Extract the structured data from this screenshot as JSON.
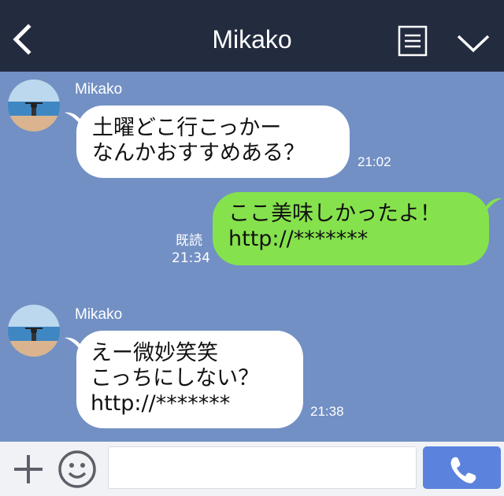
{
  "header": {
    "title": "Mikako",
    "back_icon": "chevron-left-icon",
    "menu_icon": "notes-icon",
    "expand_icon": "chevron-down-icon",
    "background_color": "#232b3f"
  },
  "chat": {
    "background_color": "#7290c4",
    "messages": [
      {
        "direction": "incoming",
        "sender": "Mikako",
        "text": "土曜どこ行こっかー\nなんかおすすめある？",
        "time": "21:02"
      },
      {
        "direction": "outgoing",
        "text": "ここ美味しかったよ！\nhttp://*******",
        "read_label": "既読",
        "time": "21:34"
      },
      {
        "direction": "incoming",
        "sender": "Mikako",
        "text": "えー微妙笑笑\nこっちにしない？\nhttp://*******",
        "time": "21:38"
      }
    ]
  },
  "composer": {
    "input_value": "",
    "plus_icon": "plus-icon",
    "emoji_icon": "smiley-icon",
    "call_icon": "phone-icon",
    "call_button_color": "#5b83de",
    "outgoing_bubble_color": "#85e24d"
  }
}
